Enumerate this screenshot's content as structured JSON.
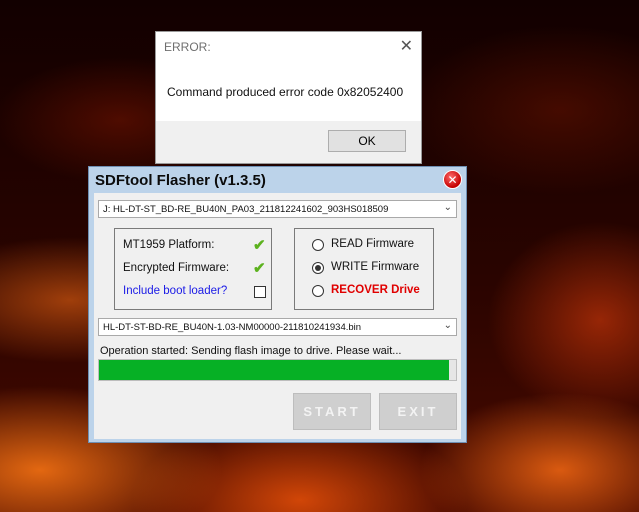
{
  "error_dialog": {
    "title": "ERROR:",
    "close_glyph": "✕",
    "message": "Command produced error code 0x82052400",
    "ok_label": "OK"
  },
  "app": {
    "title": "SDFtool Flasher (v1.3.5)",
    "close_glyph": "✕",
    "drive_select": "J:  HL-DT-ST_BD-RE_BU40N_PA03_211812241602_903HS018509",
    "info": {
      "platform_label": "MT1959 Platform:",
      "encrypted_label": "Encrypted Firmware:",
      "bootloader_label": "Include boot loader?",
      "bootloader_checked": false,
      "check_glyph": "✔"
    },
    "mode": {
      "read_label": "READ Firmware",
      "write_label": "WRITE Firmware",
      "recover_label": "RECOVER Drive",
      "selected": "write"
    },
    "firmware_select": "HL-DT-ST-BD-RE_BU40N-1.03-NM00000-211810241934.bin",
    "status": "Operation started: Sending flash image to drive. Please wait...",
    "progress_fraction": 0.98,
    "start_label": "START",
    "exit_label": "EXIT",
    "colors": {
      "progress": "#06b025",
      "recover": "#e00000",
      "bootloader": "#1a1ae6",
      "check": "#5cb21e"
    },
    "arrow_glyph": "⌄"
  }
}
